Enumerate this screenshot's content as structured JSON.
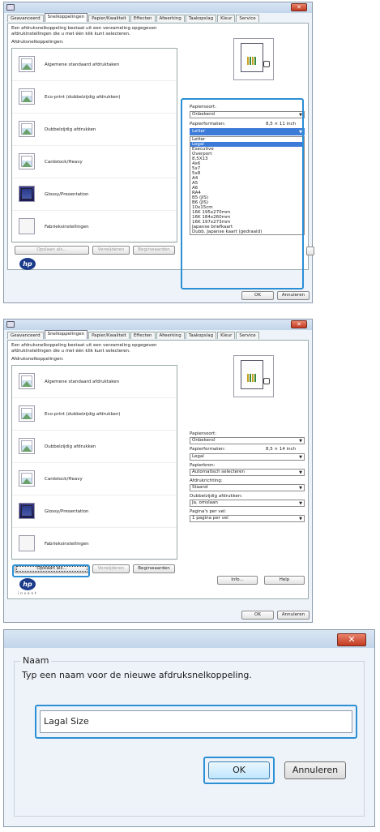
{
  "tabs": [
    "Geavanceerd",
    "Snelkoppelingen",
    "Papier/Kwaliteit",
    "Effecten",
    "Afwerking",
    "Taakopslag",
    "Kleur",
    "Service"
  ],
  "description": "Een afdruksnelkoppeling bestaat uit een verzameling opgegeven afdrukinstellingen die u met één klik kunt selecteren.",
  "shortcuts_label": "Afdruksnelkoppelingen:",
  "shortcuts": [
    {
      "label": "Algemene standaard afdruktaken",
      "icon": "document-photo-icon"
    },
    {
      "label": "Eco-print (dubbelzijdig afdrukken)",
      "icon": "document-photo-icon"
    },
    {
      "label": "Dubbelzijdig afdrukken",
      "icon": "duplex-document-icon"
    },
    {
      "label": "Cardstock/Heavy",
      "icon": "cardstock-icon"
    },
    {
      "label": "Glossy/Presentation",
      "icon": "glossy-photo-icon"
    },
    {
      "label": "Fabrieksinstellingen",
      "icon": "blank-page-icon"
    }
  ],
  "buttons": {
    "save_as": "Opslaan als...",
    "delete": "Verwijderen",
    "restore": "Beginwaarden",
    "info": "Info...",
    "help": "Help",
    "ok": "OK",
    "cancel": "Annuleren"
  },
  "brand": {
    "logo": "hp",
    "tagline": "invent"
  },
  "panel1": {
    "paper_type_label": "Papiersoort:",
    "paper_type_value": "Onbekend",
    "paper_size_label": "Papierformaten:",
    "paper_size_dims": "8,5 × 11 inch",
    "paper_size_value": "Letter",
    "paper_size_options": [
      "Letter",
      "Legal",
      "Executive",
      "Overport",
      "8,5X13",
      "4x6",
      "5x7",
      "5x8",
      "A4",
      "A5",
      "A6",
      "RA4",
      "B5 (JIS)",
      "B6 (JIS)",
      "10x15cm",
      "16K 195x270mm",
      "16K 184x260mm",
      "16K 197x273mm",
      "Japanse briefkaart",
      "Dubb. Japanse kaart (gedraaid)"
    ],
    "selected_option": "Legal"
  },
  "panel2": {
    "paper_type_label": "Papiersoort:",
    "paper_type_value": "Onbekend",
    "paper_size_label": "Papierformaten:",
    "paper_size_dims": "8,5 × 14 inch",
    "paper_size_value": "Legal",
    "paper_source_label": "Papierbron:",
    "paper_source_value": "Automatisch selecteren",
    "orientation_label": "Afdrukrichting:",
    "orientation_value": "Staand",
    "duplex_label": "Dubbelzijdig afdrukken:",
    "duplex_value": "Ja, omslaan",
    "pages_label": "Pagina's per vel:",
    "pages_value": "1 pagina per vel"
  },
  "dialog3": {
    "group_label": "Naam",
    "prompt": "Typ een naam voor de nieuwe afdruksnelkoppeling.",
    "name_value": "Lagal Size",
    "ok": "OK",
    "cancel": "Annuleren"
  },
  "colors": {
    "callout": "#2b8fd6",
    "selection": "#3d7bd8",
    "close": "#c23b22"
  }
}
